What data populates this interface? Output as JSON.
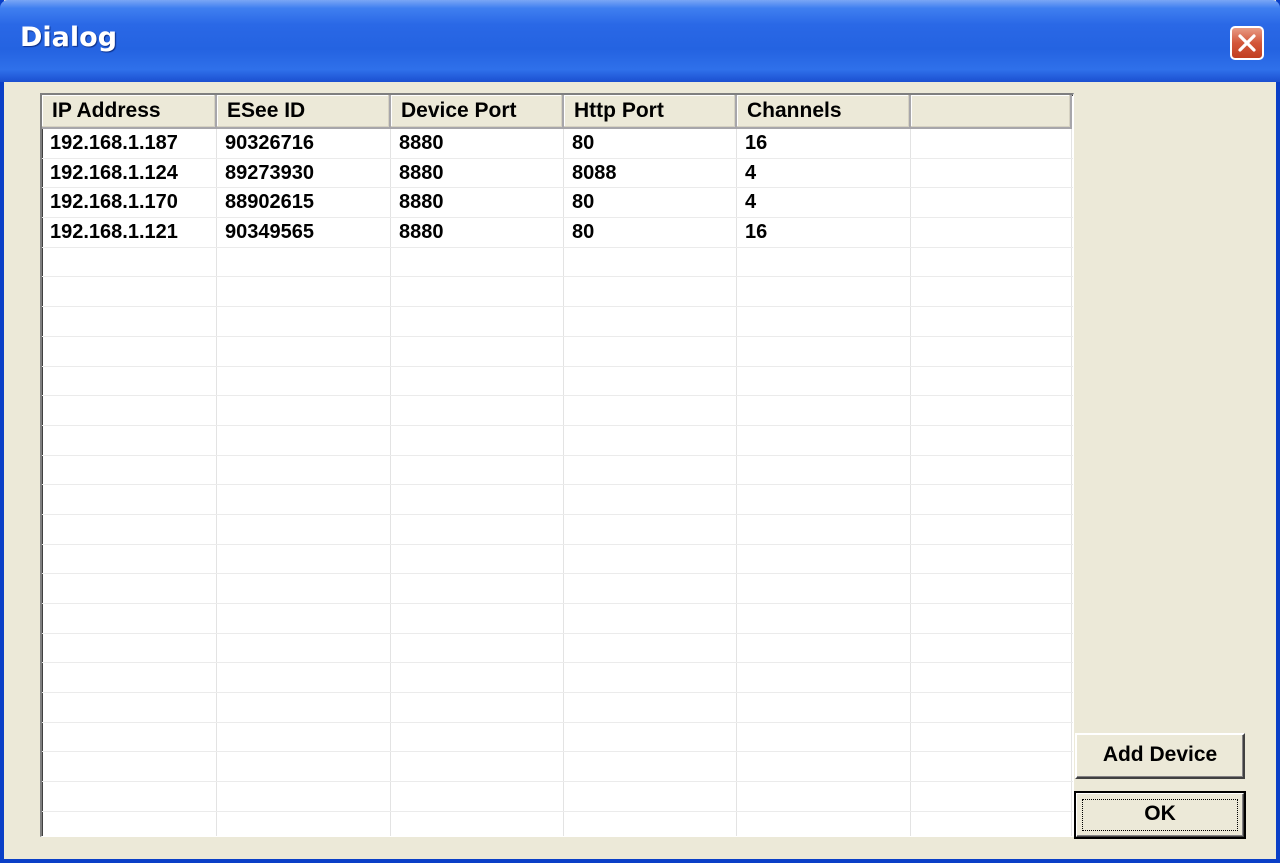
{
  "window": {
    "title": "Dialog"
  },
  "list": {
    "columns": [
      "IP Address",
      "ESee ID",
      "Device Port",
      "Http Port",
      "Channels",
      ""
    ],
    "rows": [
      [
        "192.168.1.187",
        "90326716",
        "8880",
        "80",
        "16",
        ""
      ],
      [
        "192.168.1.124",
        "89273930",
        "8880",
        "8088",
        "4",
        ""
      ],
      [
        "192.168.1.170",
        "88902615",
        "8880",
        "80",
        "4",
        ""
      ],
      [
        "192.168.1.121",
        "90349565",
        "8880",
        "80",
        "16",
        ""
      ]
    ]
  },
  "buttons": {
    "add_device": "Add Device",
    "ok": "OK"
  },
  "colors": {
    "titlebar": "#2463e1",
    "close": "#d3573a",
    "face": "#ece9d8"
  },
  "icons": {
    "close": "close-icon"
  }
}
